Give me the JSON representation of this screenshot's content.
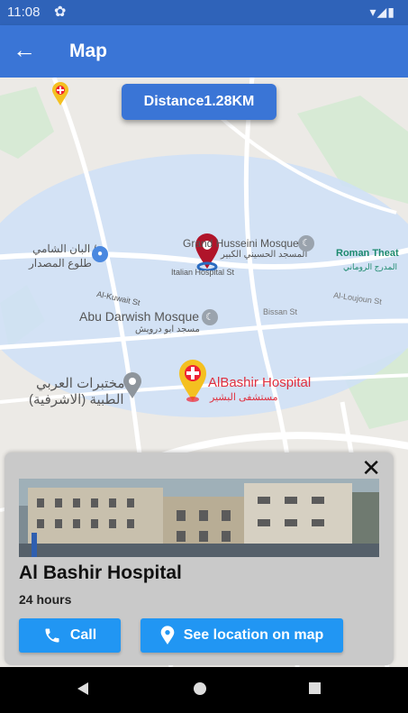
{
  "status_bar": {
    "time": "11:08"
  },
  "app_bar": {
    "title": "Map"
  },
  "map": {
    "distance_label": "Distance1.28KM",
    "labels": {
      "grand_mosque": "Grand Husseini Mosque",
      "grand_mosque_ar": "المسجد الحسيني الكبير",
      "roman_theatre": "Roman Theat",
      "roman_theatre_ar": "المدرج الروماني",
      "italian_hospital_st": "Italian Hospital St",
      "alkuwait_st": "Al-Kuwait St",
      "abu_darwish": "Abu Darwish Mosque",
      "abu_darwish_ar": "مسجد ابو درويش",
      "bissan_st": "Bissan St",
      "alloujoun_st": "Al-Loujoun St",
      "labs_ar_1": "مختبرات العربي",
      "labs_ar_2": "الطبية (الاشرفية)",
      "albashir_hospital": "AlBashir Hospital",
      "albashir_hospital_ar": "مستشفى البشير",
      "shami_ar_1": "البان الشامي /",
      "shami_ar_2": "طلوع المصدار"
    }
  },
  "place_card": {
    "name": "Al Bashir Hospital",
    "hours": "24 hours",
    "call_label": "Call",
    "location_label": "See location on map"
  },
  "colors": {
    "primary": "#3a75d6",
    "button": "#2196f3",
    "radius_fill": "#cfe0f7",
    "marker_red": "#b0142a"
  }
}
